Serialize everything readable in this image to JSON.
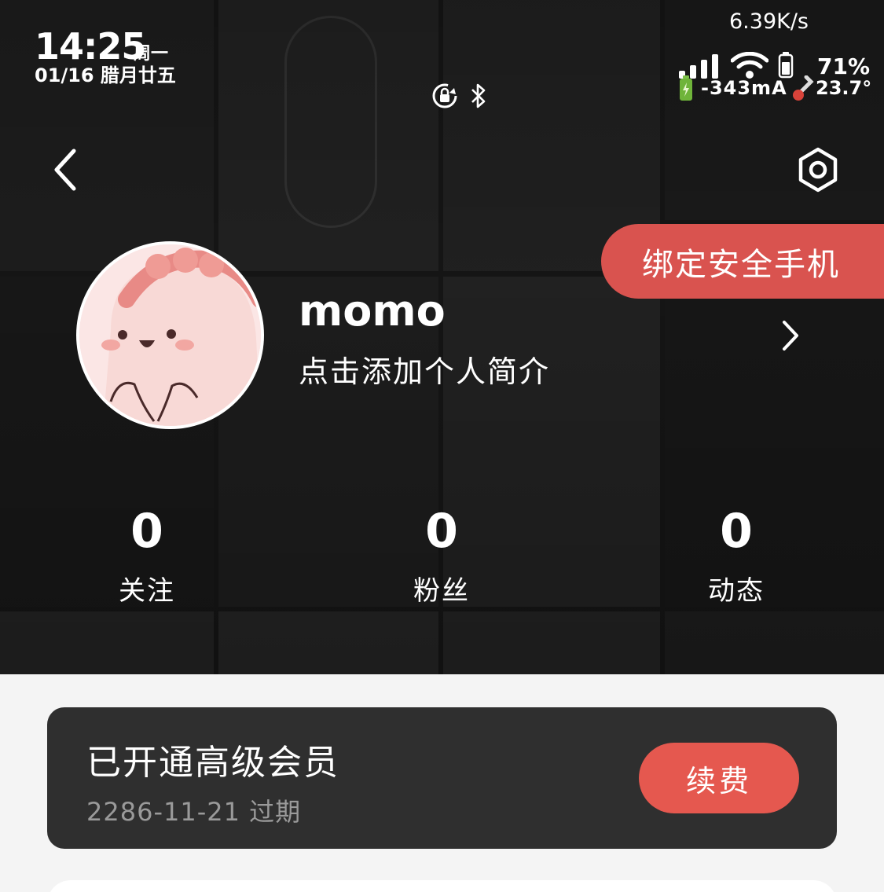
{
  "status_bar": {
    "time": "14:25",
    "weekday": "周一",
    "date": "01/16 腊月廿五",
    "net_speed": "6.39K/s",
    "battery_percent": "71%",
    "battery_level": 0.71,
    "current": "-343mA",
    "temperature": "23.7°"
  },
  "header": {
    "bind_phone_label": "绑定安全手机"
  },
  "profile": {
    "username": "momo",
    "bio_placeholder": "点击添加个人简介"
  },
  "stats": [
    {
      "value": "0",
      "label": "关注"
    },
    {
      "value": "0",
      "label": "粉丝"
    },
    {
      "value": "0",
      "label": "动态"
    }
  ],
  "membership": {
    "title": "已开通高级会员",
    "expiry": "2286-11-21 过期",
    "renew_label": "续费"
  },
  "colors": {
    "accent": "#e5584f",
    "card_bg": "#2f2f2f",
    "page_bg": "#f4f4f4"
  }
}
